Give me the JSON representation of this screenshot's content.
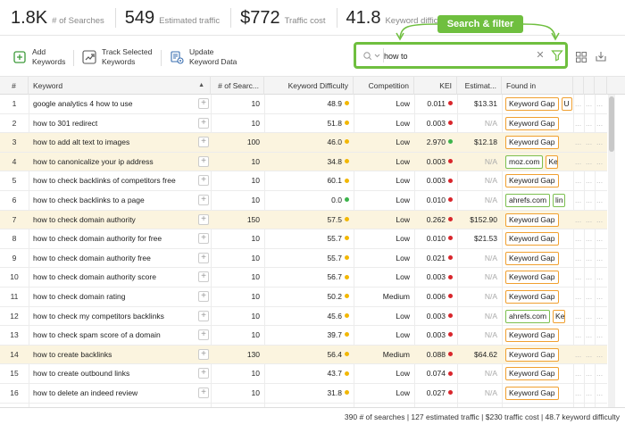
{
  "metrics": [
    {
      "value": "1.8K",
      "label": "# of Searches"
    },
    {
      "value": "549",
      "label": "Estimated traffic"
    },
    {
      "value": "$772",
      "label": "Traffic cost"
    },
    {
      "value": "41.8",
      "label": "Keyword difficulty"
    }
  ],
  "toolbar": {
    "add_label_1": "Add",
    "add_label_2": "Keywords",
    "track_label_1": "Track Selected",
    "track_label_2": "Keywords",
    "update_label_1": "Update",
    "update_label_2": "Keyword Data"
  },
  "callout": "Search & filter",
  "filter": {
    "value": "how to",
    "placeholder": "Search"
  },
  "columns": {
    "num": "#",
    "keyword": "Keyword",
    "searches": "# of Searc...",
    "kd": "Keyword Difficulty",
    "competition": "Competition",
    "kei": "KEI",
    "estimated": "Estimat...",
    "found": "Found in"
  },
  "colors": {
    "green_dot": "#3cb44b",
    "yellow_dot": "#f2b705",
    "red_dot": "#d9262c",
    "accent": "#6fbf3f",
    "highlight": "#fbf4df"
  },
  "rows": [
    {
      "num": "1",
      "keyword": "google analytics 4 how to use",
      "searches": "10",
      "kd": "48.9",
      "kd_color": "yellow",
      "comp": "Low",
      "kei": "0.011",
      "kei_color": "red",
      "est": "$13.31",
      "found": [
        {
          "text": "Keyword Gap",
          "style": "orange"
        },
        {
          "text": "U",
          "style": "orange-partial"
        }
      ],
      "hl": false
    },
    {
      "num": "2",
      "keyword": "how to 301 redirect",
      "searches": "10",
      "kd": "51.8",
      "kd_color": "yellow",
      "comp": "Low",
      "kei": "0.003",
      "kei_color": "red",
      "est": "N/A",
      "found": [
        {
          "text": "Keyword Gap",
          "style": "orange"
        }
      ],
      "hl": false
    },
    {
      "num": "3",
      "keyword": "how to add alt text to images",
      "searches": "100",
      "kd": "46.0",
      "kd_color": "yellow",
      "comp": "Low",
      "kei": "2.970",
      "kei_color": "green",
      "est": "$12.18",
      "found": [
        {
          "text": "Keyword Gap",
          "style": "orange"
        }
      ],
      "hl": true
    },
    {
      "num": "4",
      "keyword": "how to canonicalize your ip address",
      "searches": "10",
      "kd": "34.8",
      "kd_color": "yellow",
      "comp": "Low",
      "kei": "0.003",
      "kei_color": "red",
      "est": "N/A",
      "found": [
        {
          "text": "moz.com",
          "style": "green"
        },
        {
          "text": "Keyw",
          "style": "orange-partial"
        }
      ],
      "hl": true
    },
    {
      "num": "5",
      "keyword": "how to check backlinks of competitors free",
      "searches": "10",
      "kd": "60.1",
      "kd_color": "yellow",
      "comp": "Low",
      "kei": "0.003",
      "kei_color": "red",
      "est": "N/A",
      "found": [
        {
          "text": "Keyword Gap",
          "style": "orange"
        }
      ],
      "hl": false
    },
    {
      "num": "6",
      "keyword": "how to check backlinks to a page",
      "searches": "10",
      "kd": "0.0",
      "kd_color": "green",
      "comp": "Low",
      "kei": "0.010",
      "kei_color": "red",
      "est": "N/A",
      "found": [
        {
          "text": "ahrefs.com",
          "style": "green"
        },
        {
          "text": "lin",
          "style": "green-partial"
        }
      ],
      "hl": false
    },
    {
      "num": "7",
      "keyword": "how to check domain authority",
      "searches": "150",
      "kd": "57.5",
      "kd_color": "yellow",
      "comp": "Low",
      "kei": "0.262",
      "kei_color": "red",
      "est": "$152.90",
      "found": [
        {
          "text": "Keyword Gap",
          "style": "orange"
        }
      ],
      "hl": true
    },
    {
      "num": "8",
      "keyword": "how to check domain authority for free",
      "searches": "10",
      "kd": "55.7",
      "kd_color": "yellow",
      "comp": "Low",
      "kei": "0.010",
      "kei_color": "red",
      "est": "$21.53",
      "found": [
        {
          "text": "Keyword Gap",
          "style": "orange"
        }
      ],
      "hl": false
    },
    {
      "num": "9",
      "keyword": "how to check domain authority free",
      "searches": "10",
      "kd": "55.7",
      "kd_color": "yellow",
      "comp": "Low",
      "kei": "0.021",
      "kei_color": "red",
      "est": "N/A",
      "found": [
        {
          "text": "Keyword Gap",
          "style": "orange"
        }
      ],
      "hl": false
    },
    {
      "num": "10",
      "keyword": "how to check domain authority score",
      "searches": "10",
      "kd": "56.7",
      "kd_color": "yellow",
      "comp": "Low",
      "kei": "0.003",
      "kei_color": "red",
      "est": "N/A",
      "found": [
        {
          "text": "Keyword Gap",
          "style": "orange"
        }
      ],
      "hl": false
    },
    {
      "num": "11",
      "keyword": "how to check domain rating",
      "searches": "10",
      "kd": "50.2",
      "kd_color": "yellow",
      "comp": "Medium",
      "kei": "0.006",
      "kei_color": "red",
      "est": "N/A",
      "found": [
        {
          "text": "Keyword Gap",
          "style": "orange"
        }
      ],
      "hl": false
    },
    {
      "num": "12",
      "keyword": "how to check my competitors backlinks",
      "searches": "10",
      "kd": "45.6",
      "kd_color": "yellow",
      "comp": "Low",
      "kei": "0.003",
      "kei_color": "red",
      "est": "N/A",
      "found": [
        {
          "text": "ahrefs.com",
          "style": "green"
        },
        {
          "text": "Ke",
          "style": "orange-partial"
        }
      ],
      "hl": false
    },
    {
      "num": "13",
      "keyword": "how to check spam score of a domain",
      "searches": "10",
      "kd": "39.7",
      "kd_color": "yellow",
      "comp": "Low",
      "kei": "0.003",
      "kei_color": "red",
      "est": "N/A",
      "found": [
        {
          "text": "Keyword Gap",
          "style": "orange"
        }
      ],
      "hl": false
    },
    {
      "num": "14",
      "keyword": "how to create backlinks",
      "searches": "130",
      "kd": "56.4",
      "kd_color": "yellow",
      "comp": "Medium",
      "kei": "0.088",
      "kei_color": "red",
      "est": "$64.62",
      "found": [
        {
          "text": "Keyword Gap",
          "style": "orange"
        }
      ],
      "hl": true
    },
    {
      "num": "15",
      "keyword": "how to create outbound links",
      "searches": "10",
      "kd": "43.7",
      "kd_color": "yellow",
      "comp": "Low",
      "kei": "0.074",
      "kei_color": "red",
      "est": "N/A",
      "found": [
        {
          "text": "Keyword Gap",
          "style": "orange"
        }
      ],
      "hl": false
    },
    {
      "num": "16",
      "keyword": "how to delete an indeed review",
      "searches": "10",
      "kd": "31.8",
      "kd_color": "yellow",
      "comp": "Low",
      "kei": "0.027",
      "kei_color": "red",
      "est": "N/A",
      "found": [
        {
          "text": "Keyword Gap",
          "style": "orange"
        }
      ],
      "hl": false
    }
  ],
  "extra_cells": "...",
  "footer": "390 # of searches | 127 estimated traffic | $230 traffic cost | 48.7 keyword difficulty"
}
